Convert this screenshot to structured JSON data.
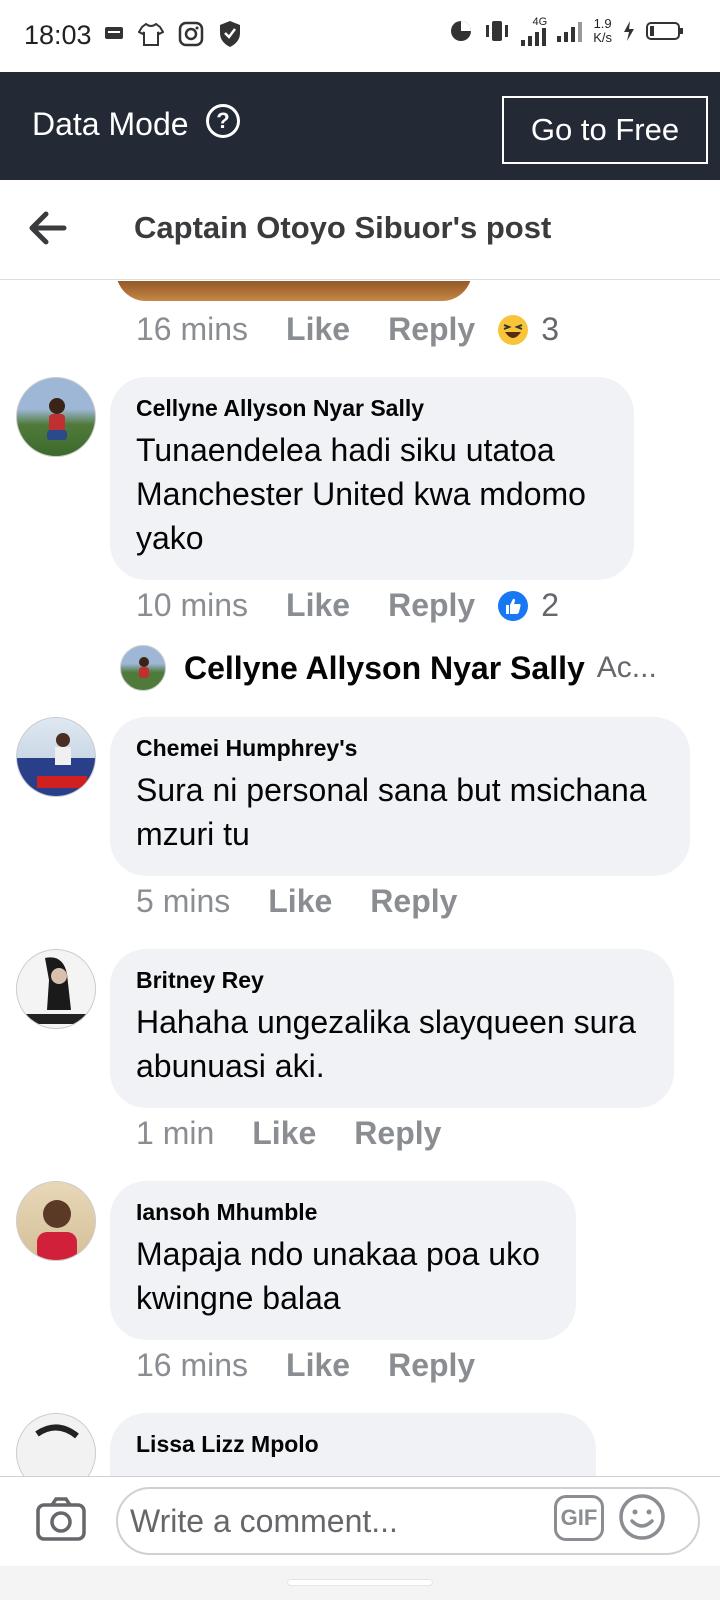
{
  "status_bar": {
    "time": "18:03",
    "network_label": "4G",
    "speed_value": "1.9",
    "speed_unit": "K/s",
    "left_icons": [
      "message-icon",
      "shirt-icon",
      "instagram-icon",
      "shield-icon"
    ],
    "right_icons": [
      "data-saver-icon",
      "vibrate-icon",
      "signal-icon",
      "signal-icon",
      "charging-icon",
      "battery-icon"
    ]
  },
  "data_mode": {
    "label": "Data Mode",
    "help_glyph": "?",
    "go_free_label": "Go to Free"
  },
  "header": {
    "title": "Captain Otoyo Sibuor's post"
  },
  "top_comment_meta": {
    "time": "16 mins",
    "like": "Like",
    "reply": "Reply",
    "reaction_icon": "haha-emoji-icon",
    "reaction_count": "3"
  },
  "comments": [
    {
      "author": "Cellyne Allyson Nyar Sally",
      "text": "Tunaendelea hadi siku utatoa Manchester United kwa mdomo yako",
      "time": "10 mins",
      "like": "Like",
      "reply": "Reply",
      "reaction_icon": "like-reaction-icon",
      "reaction_count": "2",
      "reply_preview": {
        "author": "Cellyne Allyson Nyar Sally",
        "text": "Ac..."
      }
    },
    {
      "author": "Chemei Humphrey's",
      "text": "Sura ni personal sana but msichana mzuri tu",
      "time": "5 mins",
      "like": "Like",
      "reply": "Reply"
    },
    {
      "author": "Britney Rey",
      "text": "Hahaha ungezalika slayqueen sura abunuasi aki.",
      "time": "1 min",
      "like": "Like",
      "reply": "Reply"
    },
    {
      "author": "Iansoh Mhumble",
      "text": "Mapaja ndo unakaa poa uko kwingne balaa",
      "time": "16 mins",
      "like": "Like",
      "reply": "Reply"
    },
    {
      "author": "Lissa Lizz Mpolo"
    }
  ],
  "composer": {
    "placeholder": "Write a comment...",
    "gif_label": "GIF"
  },
  "colors": {
    "data_bar_bg": "#232a35",
    "bubble_bg": "#f0f2f5",
    "meta_gray": "#8a8d91",
    "like_blue": "#1877f2",
    "haha_yellow": "#f7c43a"
  }
}
